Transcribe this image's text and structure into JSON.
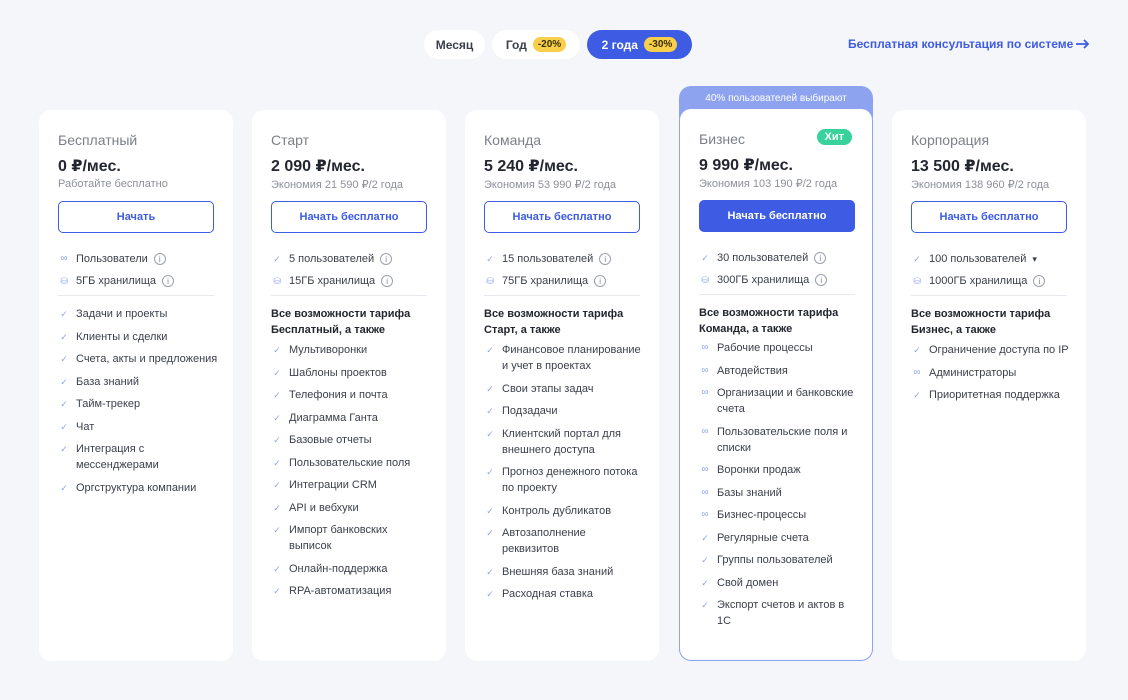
{
  "periods": [
    {
      "label": "Месяц",
      "discount": "",
      "active": false
    },
    {
      "label": "Год",
      "discount": "-20%",
      "active": false
    },
    {
      "label": "2 года",
      "discount": "-30%",
      "active": true
    }
  ],
  "consult_link": "Бесплатная консультация по системе",
  "popular_banner": "40% пользователей выбирают",
  "colors": {
    "accent": "#3d5be3",
    "accent_light": "#8ea3f0",
    "hit": "#37d39b",
    "discount": "#f7cf4a"
  },
  "icons": {
    "check": "check-icon",
    "infinity": "infinity-icon",
    "storage": "database-icon",
    "info": "info-icon",
    "arrow": "arrow-right-icon",
    "chevron": "chevron-down-icon"
  },
  "plans": [
    {
      "name": "Бесплатный",
      "price": "0 ₽/мес.",
      "note": "Работайте бесплатно",
      "cta": "Начать",
      "primary": false,
      "badge": "",
      "limits": [
        {
          "icon": "inf",
          "text": "Пользователи",
          "suffix": "info"
        },
        {
          "icon": "db",
          "text": "5ГБ хранилища",
          "suffix": "info"
        }
      ],
      "section_title": "",
      "features": [
        {
          "icon": "check",
          "text": "Задачи и проекты"
        },
        {
          "icon": "check",
          "text": "Клиенты и сделки"
        },
        {
          "icon": "check",
          "text": "Счета, акты и предложения"
        },
        {
          "icon": "check",
          "text": "База знаний"
        },
        {
          "icon": "check",
          "text": "Тайм-трекер"
        },
        {
          "icon": "check",
          "text": "Чат"
        },
        {
          "icon": "check",
          "text": "Интеграция с мессенджерами"
        },
        {
          "icon": "check",
          "text": "Оргструктура компании"
        }
      ]
    },
    {
      "name": "Старт",
      "price": "2 090 ₽/мес.",
      "note": "Экономия 21 590 ₽/2 года",
      "cta": "Начать бесплатно",
      "primary": false,
      "badge": "",
      "limits": [
        {
          "icon": "check",
          "text": "5 пользователей",
          "suffix": "info"
        },
        {
          "icon": "db",
          "text": "15ГБ хранилища",
          "suffix": "info"
        }
      ],
      "section_title": "Все возможности тарифа Бесплатный, а также",
      "features": [
        {
          "icon": "check",
          "text": "Мультиворонки"
        },
        {
          "icon": "check",
          "text": "Шаблоны проектов"
        },
        {
          "icon": "check",
          "text": "Телефония и почта"
        },
        {
          "icon": "check",
          "text": "Диаграмма Ганта"
        },
        {
          "icon": "check",
          "text": "Базовые отчеты"
        },
        {
          "icon": "check",
          "text": "Пользовательские поля"
        },
        {
          "icon": "check",
          "text": "Интеграции CRM"
        },
        {
          "icon": "check",
          "text": "API и вебхуки"
        },
        {
          "icon": "check",
          "text": "Импорт банковских выписок"
        },
        {
          "icon": "check",
          "text": "Онлайн-поддержка"
        },
        {
          "icon": "check",
          "text": "RPA-автоматизация"
        }
      ]
    },
    {
      "name": "Команда",
      "price": "5 240 ₽/мес.",
      "note": "Экономия 53 990 ₽/2 года",
      "cta": "Начать бесплатно",
      "primary": false,
      "badge": "",
      "limits": [
        {
          "icon": "check",
          "text": "15 пользователей",
          "suffix": "info"
        },
        {
          "icon": "db",
          "text": "75ГБ хранилища",
          "suffix": "info"
        }
      ],
      "section_title": "Все возможности тарифа Старт, а также",
      "features": [
        {
          "icon": "check",
          "text": "Финансовое планирование и учет в проектах"
        },
        {
          "icon": "check",
          "text": "Свои этапы задач"
        },
        {
          "icon": "check",
          "text": "Подзадачи"
        },
        {
          "icon": "check",
          "text": "Клиентский портал для внешнего доступа"
        },
        {
          "icon": "check",
          "text": "Прогноз денежного потока по проекту"
        },
        {
          "icon": "check",
          "text": "Контроль дубликатов"
        },
        {
          "icon": "check",
          "text": "Автозаполнение реквизитов"
        },
        {
          "icon": "check",
          "text": "Внешняя база знаний"
        },
        {
          "icon": "check",
          "text": "Расходная ставка"
        }
      ]
    },
    {
      "name": "Бизнес",
      "price": "9 990 ₽/мес.",
      "note": "Экономия 103 190 ₽/2 года",
      "cta": "Начать бесплатно",
      "primary": true,
      "badge": "Хит",
      "limits": [
        {
          "icon": "check",
          "text": "30 пользователей",
          "suffix": "info"
        },
        {
          "icon": "db",
          "text": "300ГБ хранилища",
          "suffix": "info"
        }
      ],
      "section_title": "Все возможности тарифа Команда, а также",
      "features": [
        {
          "icon": "inf",
          "text": "Рабочие процессы"
        },
        {
          "icon": "inf",
          "text": "Автодействия"
        },
        {
          "icon": "inf",
          "text": "Организации и банковские счета"
        },
        {
          "icon": "inf",
          "text": "Пользовательские поля и списки"
        },
        {
          "icon": "inf",
          "text": "Воронки продаж"
        },
        {
          "icon": "inf",
          "text": "Базы знаний"
        },
        {
          "icon": "inf",
          "text": "Бизнес-процессы"
        },
        {
          "icon": "check",
          "text": "Регулярные счета"
        },
        {
          "icon": "check",
          "text": "Группы пользователей"
        },
        {
          "icon": "check",
          "text": "Свой домен"
        },
        {
          "icon": "check",
          "text": "Экспорт счетов и актов в 1С"
        }
      ]
    },
    {
      "name": "Корпорация",
      "price": "13 500 ₽/мес.",
      "note": "Экономия 138 960 ₽/2 года",
      "cta": "Начать бесплатно",
      "primary": false,
      "badge": "",
      "limits": [
        {
          "icon": "check",
          "text": "100 пользователей",
          "suffix": "chevron"
        },
        {
          "icon": "db",
          "text": "1000ГБ хранилища",
          "suffix": "info"
        }
      ],
      "section_title": "Все возможности тарифа Бизнес, а также",
      "features": [
        {
          "icon": "check",
          "text": "Ограничение доступа по IP"
        },
        {
          "icon": "inf",
          "text": "Администраторы"
        },
        {
          "icon": "check",
          "text": "Приоритетная поддержка"
        }
      ]
    }
  ]
}
